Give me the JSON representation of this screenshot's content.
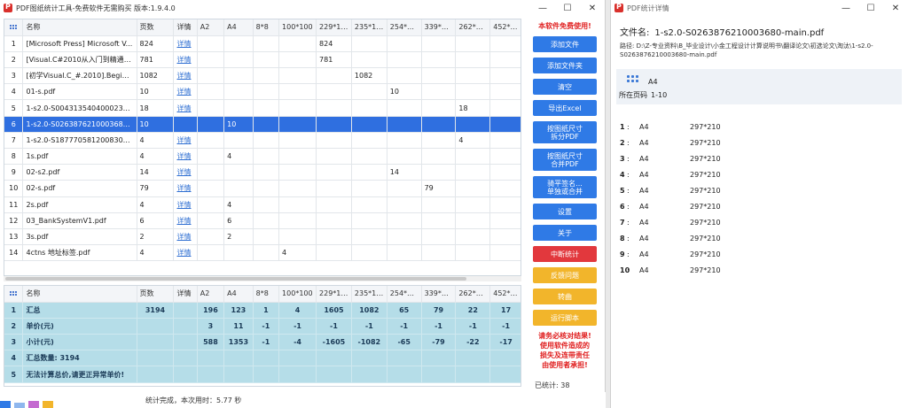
{
  "main_window": {
    "title": "PDF图纸统计工具-免费软件无需购买 版本:1.9.4.0",
    "controls": [
      "—",
      "☐",
      "✕"
    ]
  },
  "top_table": {
    "columns": [
      "名称",
      "页数",
      "详情",
      "A2",
      "A4",
      "8*8",
      "100*100",
      "229*187",
      "235*187",
      "254*190",
      "339*190",
      "262*192",
      "452*254"
    ],
    "rows": [
      {
        "idx": "1",
        "name": "[Microsoft Press] Microsoft V...",
        "pages": "824",
        "detail": "详情",
        "cells": [
          "",
          "",
          "",
          "",
          "824",
          "",
          "",
          "",
          "",
          ""
        ]
      },
      {
        "idx": "2",
        "name": "[Visual.C#2010从入门到精通].[...",
        "pages": "781",
        "detail": "详情",
        "cells": [
          "",
          "",
          "",
          "",
          "781",
          "",
          "",
          "",
          "",
          ""
        ]
      },
      {
        "idx": "3",
        "name": "[初学Visual.C_#.2010].Beginni...",
        "pages": "1082",
        "detail": "详情",
        "cells": [
          "",
          "",
          "",
          "",
          "",
          "1082",
          "",
          "",
          "",
          ""
        ]
      },
      {
        "idx": "4",
        "name": "01-s.pdf",
        "pages": "10",
        "detail": "详情",
        "cells": [
          "",
          "",
          "",
          "",
          "",
          "",
          "10",
          "",
          "",
          ""
        ]
      },
      {
        "idx": "5",
        "name": "1-s2.0-S0043135404000235-...",
        "pages": "18",
        "detail": "详情",
        "cells": [
          "",
          "",
          "",
          "",
          "",
          "",
          "",
          "",
          "18",
          ""
        ]
      },
      {
        "idx": "6",
        "name": "1-s2.0-S0263876210003680-...",
        "pages": "10",
        "detail": "",
        "cells": [
          "",
          "10",
          "",
          "",
          "",
          "",
          "",
          "",
          "",
          ""
        ],
        "selected": true
      },
      {
        "idx": "7",
        "name": "1-s2.0-S1877705812008302-...",
        "pages": "4",
        "detail": "详情",
        "cells": [
          "",
          "",
          "",
          "",
          "",
          "",
          "",
          "",
          "4",
          ""
        ]
      },
      {
        "idx": "8",
        "name": "1s.pdf",
        "pages": "4",
        "detail": "详情",
        "cells": [
          "",
          "4",
          "",
          "",
          "",
          "",
          "",
          "",
          "",
          ""
        ]
      },
      {
        "idx": "9",
        "name": "02-s2.pdf",
        "pages": "14",
        "detail": "详情",
        "cells": [
          "",
          "",
          "",
          "",
          "",
          "",
          "14",
          "",
          "",
          ""
        ]
      },
      {
        "idx": "10",
        "name": "02-s.pdf",
        "pages": "79",
        "detail": "详情",
        "cells": [
          "",
          "",
          "",
          "",
          "",
          "",
          "",
          "79",
          "",
          ""
        ]
      },
      {
        "idx": "11",
        "name": "2s.pdf",
        "pages": "4",
        "detail": "详情",
        "cells": [
          "",
          "4",
          "",
          "",
          "",
          "",
          "",
          "",
          "",
          ""
        ]
      },
      {
        "idx": "12",
        "name": "03_BankSystemV1.pdf",
        "pages": "6",
        "detail": "详情",
        "cells": [
          "",
          "6",
          "",
          "",
          "",
          "",
          "",
          "",
          "",
          ""
        ]
      },
      {
        "idx": "13",
        "name": "3s.pdf",
        "pages": "2",
        "detail": "详情",
        "cells": [
          "",
          "2",
          "",
          "",
          "",
          "",
          "",
          "",
          "",
          ""
        ]
      },
      {
        "idx": "14",
        "name": "4ctns 地址标签.pdf",
        "pages": "4",
        "detail": "详情",
        "cells": [
          "",
          "",
          "",
          "4",
          "",
          "",
          "",
          "",
          "",
          ""
        ]
      }
    ]
  },
  "bottom_table": {
    "columns": [
      "名称",
      "页数",
      "详情",
      "A2",
      "A4",
      "8*8",
      "100*100",
      "229*187",
      "235*187",
      "254*190",
      "339*190",
      "262*192",
      "452*254"
    ],
    "rows": [
      {
        "idx": "1",
        "name": "汇总",
        "pages": "3194",
        "cells": [
          "196",
          "123",
          "1",
          "4",
          "1605",
          "1082",
          "65",
          "79",
          "22",
          "17"
        ]
      },
      {
        "idx": "2",
        "name": "单价(元)",
        "pages": "",
        "cells": [
          "3",
          "11",
          "-1",
          "-1",
          "-1",
          "-1",
          "-1",
          "-1",
          "-1",
          "-1"
        ]
      },
      {
        "idx": "3",
        "name": "小计(元)",
        "pages": "",
        "cells": [
          "588",
          "1353",
          "-1",
          "-4",
          "-1605",
          "-1082",
          "-65",
          "-79",
          "-22",
          "-17"
        ]
      },
      {
        "idx": "4",
        "name": "汇总数量: 3194",
        "pages": "",
        "cells": [
          "",
          "",
          "",
          "",
          "",
          "",
          "",
          "",
          "",
          ""
        ]
      },
      {
        "idx": "5",
        "name": "无法计算总价,请更正异常单价!",
        "pages": "",
        "cells": [
          "",
          "",
          "",
          "",
          "",
          "",
          "",
          "",
          "",
          ""
        ],
        "warn": true
      }
    ]
  },
  "side": {
    "promo": "本软件免费使用!",
    "buttons": [
      {
        "label": "添加文件",
        "color": "blue"
      },
      {
        "label": "添加文件夹",
        "color": "blue"
      },
      {
        "label": "清空",
        "color": "blue"
      },
      {
        "label": "导出Excel",
        "color": "blue"
      },
      {
        "label": "按图纸尺寸\n拆分PDF",
        "color": "blue",
        "tall": true
      },
      {
        "label": "按图纸尺寸\n合并PDF",
        "color": "blue",
        "tall": true
      },
      {
        "label": "骑平签名...\n单独或合并",
        "color": "blue",
        "tall": true
      },
      {
        "label": "设置",
        "color": "blue"
      },
      {
        "label": "关于",
        "color": "blue"
      },
      {
        "label": "中断统计",
        "color": "red"
      },
      {
        "label": "反馈问题",
        "color": "orange"
      },
      {
        "label": "转曲",
        "color": "orange"
      },
      {
        "label": "运行脚本",
        "color": "orange"
      }
    ],
    "warning": "请务必核对结果!\n使用软件造成的\n损失及连带责任\n由使用者承担!",
    "count_label": "已统计: 38"
  },
  "status": {
    "text": "统计完成，本次用时：5.77 秒",
    "tray_colors": [
      "#2f7ae6",
      "#8fb7ee",
      "#c46ad0",
      "#f2b52b"
    ]
  },
  "detail_window": {
    "title": "PDF统计详情",
    "file_label": "文件名:",
    "file_name": "1-s2.0-S0263876210003680-main.pdf",
    "path": "路径: D:\\Z-专业资料\\B_毕业设计\\小金工程设计计算说明书\\翻译论文\\初选论文\\淘汰\\1-s2.0-S0263876210003680-main.pdf",
    "size_name": "A4",
    "range_label": "所在页码",
    "range_value": "1-10",
    "pages": [
      {
        "n": "1",
        "size": "A4",
        "dim": "297*210"
      },
      {
        "n": "2",
        "size": "A4",
        "dim": "297*210"
      },
      {
        "n": "3",
        "size": "A4",
        "dim": "297*210"
      },
      {
        "n": "4",
        "size": "A4",
        "dim": "297*210"
      },
      {
        "n": "5",
        "size": "A4",
        "dim": "297*210"
      },
      {
        "n": "6",
        "size": "A4",
        "dim": "297*210"
      },
      {
        "n": "7",
        "size": "A4",
        "dim": "297*210"
      },
      {
        "n": "8",
        "size": "A4",
        "dim": "297*210"
      },
      {
        "n": "9",
        "size": "A4",
        "dim": "297*210"
      },
      {
        "n": "10",
        "size": "A4",
        "dim": "297*210"
      }
    ]
  }
}
